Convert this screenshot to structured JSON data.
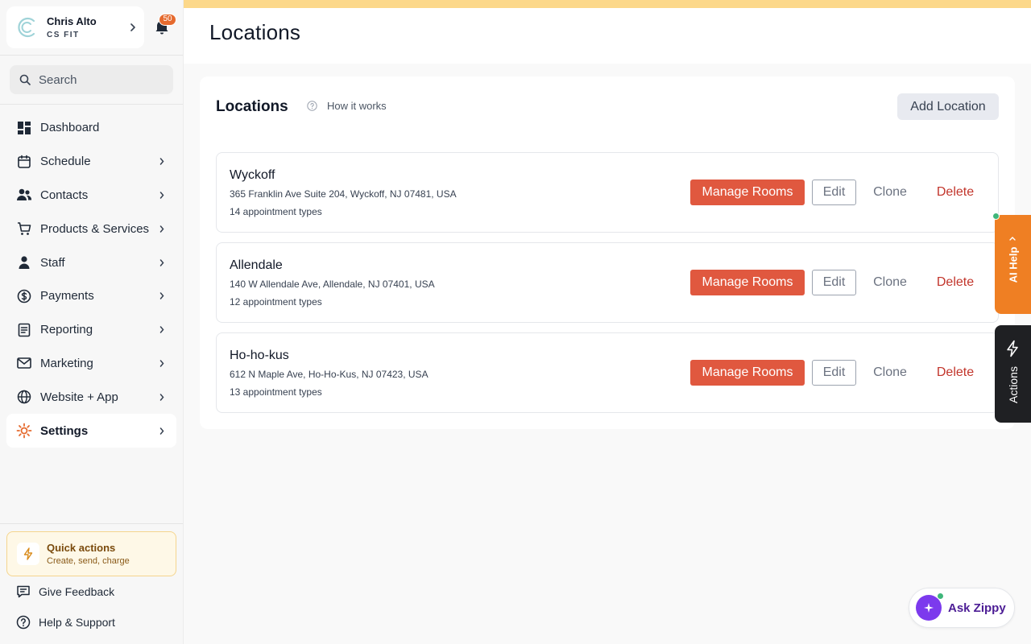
{
  "account": {
    "user": "Chris Alto",
    "org": "CS FIT"
  },
  "notifications": {
    "count": "50"
  },
  "search": {
    "placeholder": "Search"
  },
  "nav": [
    {
      "label": "Dashboard",
      "icon": "dashboard-icon",
      "arrow": false,
      "active": false
    },
    {
      "label": "Schedule",
      "icon": "calendar-icon",
      "arrow": true,
      "active": false
    },
    {
      "label": "Contacts",
      "icon": "contacts-icon",
      "arrow": true,
      "active": false
    },
    {
      "label": "Products & Services",
      "icon": "cart-icon",
      "arrow": true,
      "active": false
    },
    {
      "label": "Staff",
      "icon": "person-icon",
      "arrow": true,
      "active": false
    },
    {
      "label": "Payments",
      "icon": "dollar-icon",
      "arrow": true,
      "active": false
    },
    {
      "label": "Reporting",
      "icon": "report-icon",
      "arrow": true,
      "active": false
    },
    {
      "label": "Marketing",
      "icon": "mail-icon",
      "arrow": true,
      "active": false
    },
    {
      "label": "Website + App",
      "icon": "globe-icon",
      "arrow": true,
      "active": false
    },
    {
      "label": "Settings",
      "icon": "sun-icon",
      "arrow": true,
      "active": true
    }
  ],
  "quick_actions": {
    "title": "Quick actions",
    "subtitle": "Create, send, charge"
  },
  "footer": {
    "feedback": "Give Feedback",
    "help": "Help & Support"
  },
  "page": {
    "title": "Locations"
  },
  "panel": {
    "title": "Locations",
    "how_it_works": "How it works",
    "add_label": "Add Location"
  },
  "actions": {
    "manage": "Manage Rooms",
    "edit": "Edit",
    "clone": "Clone",
    "delete": "Delete"
  },
  "locations": [
    {
      "name": "Wyckoff",
      "address": "365 Franklin Ave Suite 204, Wyckoff, NJ 07481, USA",
      "types": "14 appointment types"
    },
    {
      "name": "Allendale",
      "address": "140 W Allendale Ave, Allendale, NJ 07401, USA",
      "types": "12 appointment types"
    },
    {
      "name": "Ho-ho-kus",
      "address": "612 N Maple Ave, Ho-Ho-Kus, NJ 07423, USA",
      "types": "13 appointment types"
    }
  ],
  "side_tabs": {
    "ai_help": "AI Help",
    "actions": "Actions"
  },
  "zippy": {
    "label": "Ask Zippy"
  },
  "colors": {
    "accent": "#e0583f",
    "ai_tab": "#ef7f23",
    "actions_tab": "#1f2023",
    "delete": "#c2352b",
    "zippy": "#7c3aed",
    "banner": "#fcd88a"
  }
}
